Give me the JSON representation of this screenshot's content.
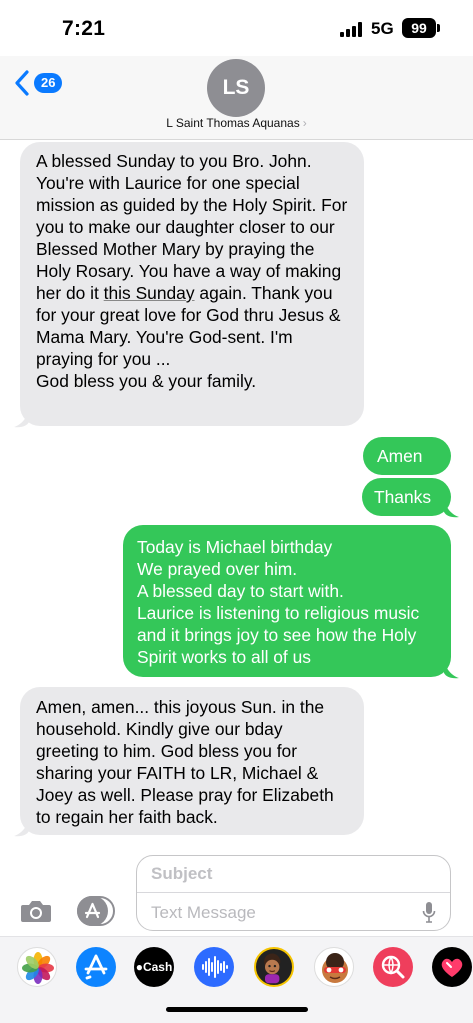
{
  "status": {
    "time": "7:21",
    "network": "5G",
    "battery": "99"
  },
  "header": {
    "back_badge": "26",
    "avatar_initials": "LS",
    "contact_name": "L Saint Thomas Aquanas"
  },
  "messages": [
    {
      "direction": "incoming",
      "text_before": "A blessed Sunday to you Bro. John. You're with Laurice for one special mission as guided by the Holy Spirit. For you to make our daughter closer to our Blessed Mother Mary by praying the Holy Rosary. You have a way of making her do it ",
      "text_underlined": "this Sunday",
      "text_after": " again. Thank you for your great love for God thru Jesus & Mama Mary. You're God-sent. I'm praying for you ...\n God bless you & your family."
    },
    {
      "direction": "outgoing",
      "text": "Amen"
    },
    {
      "direction": "outgoing",
      "text": "Thanks"
    },
    {
      "direction": "outgoing",
      "text": "Today is Michael birthday\nWe prayed over him.\nA blessed day to start with.\nLaurice is listening to religious music and it brings joy to see how the Holy Spirit works to all of us"
    },
    {
      "direction": "incoming",
      "text": "Amen, amen... this joyous Sun. in the household. Kindly give our bday greeting to him. God bless you for sharing your FAITH to LR, Michael & Joey as well. Please pray for Elizabeth to regain her faith back."
    }
  ],
  "compose": {
    "subject_placeholder": "Subject",
    "message_placeholder": "Text Message"
  },
  "app_drawer": {
    "apps": [
      {
        "name": "photos-app",
        "icon": "photos-icon"
      },
      {
        "name": "app-store-app",
        "icon": "app-store-icon"
      },
      {
        "name": "cash-app",
        "icon": "apple-cash-icon",
        "label": "Cash"
      },
      {
        "name": "audio-message-app",
        "icon": "waveform-icon"
      },
      {
        "name": "memoji-app",
        "icon": "memoji-icon"
      },
      {
        "name": "animoji-app",
        "icon": "animoji-icon"
      },
      {
        "name": "search-images-app",
        "icon": "globe-search-icon"
      },
      {
        "name": "digital-touch-app",
        "icon": "heart-icon"
      }
    ]
  },
  "colors": {
    "incoming_bubble": "#e9e9eb",
    "outgoing_bubble": "#34c759",
    "accent": "#0a7aff"
  }
}
